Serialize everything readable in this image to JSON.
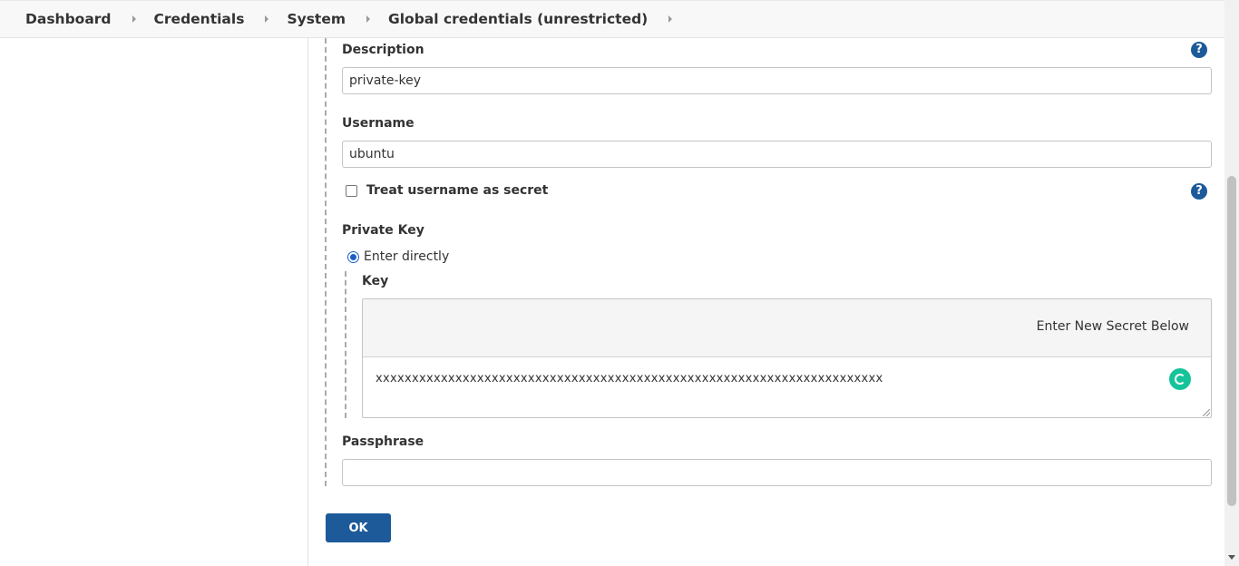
{
  "breadcrumb": {
    "items": [
      {
        "label": "Dashboard"
      },
      {
        "label": "Credentials"
      },
      {
        "label": "System"
      },
      {
        "label": "Global credentials (unrestricted)"
      }
    ]
  },
  "form": {
    "description": {
      "label": "Description",
      "value": "private-key"
    },
    "username": {
      "label": "Username",
      "value": "ubuntu"
    },
    "treat_username_secret": {
      "label": "Treat username as secret",
      "checked": false
    },
    "private_key": {
      "label": "Private Key",
      "option_label": "Enter directly",
      "key_label": "Key",
      "secret_header": "Enter New Secret Below",
      "secret_value": "xxxxxxxxxxxxxxxxxxxxxxxxxxxxxxxxxxxxxxxxxxxxxxxxxxxxxxxxxxxxxxxxxxxxxx"
    },
    "passphrase": {
      "label": "Passphrase",
      "value": ""
    },
    "help_glyph": "?",
    "ok_label": "OK"
  },
  "colors": {
    "primary": "#1d5a9a",
    "grammarly": "#15c39a"
  },
  "icons": {
    "help": "help-icon",
    "breadcrumb_separator": "chevron-right-icon",
    "grammarly": "grammarly-icon"
  }
}
